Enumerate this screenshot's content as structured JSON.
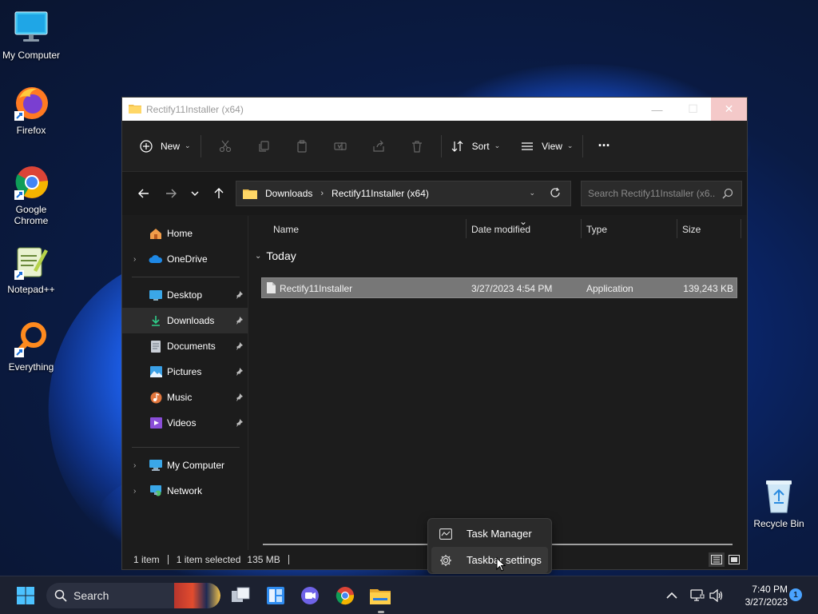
{
  "desktop": {
    "icons": [
      {
        "label": "My Computer",
        "icon": "monitor-icon"
      },
      {
        "label": "Firefox",
        "icon": "firefox-icon"
      },
      {
        "label": "Google Chrome",
        "icon": "chrome-icon"
      },
      {
        "label": "Notepad++",
        "icon": "notepadpp-icon"
      },
      {
        "label": "Everything",
        "icon": "everything-search-icon"
      },
      {
        "label": "Recycle Bin",
        "icon": "recycle-bin-icon"
      }
    ]
  },
  "window": {
    "title": "Rectify11Installer (x64)",
    "controls": {
      "minimize": "—",
      "maximize": "☐",
      "close": "✕"
    }
  },
  "command_bar": {
    "new_label": "New",
    "sort_label": "Sort",
    "view_label": "View",
    "more_label": "···"
  },
  "address_bar": {
    "crumbs": [
      "Downloads",
      "Rectify11Installer (x64)"
    ],
    "search_placeholder": "Search Rectify11Installer (x6..."
  },
  "nav_pane": {
    "items": [
      {
        "label": "Home",
        "icon": "home-icon"
      },
      {
        "label": "OneDrive",
        "icon": "onedrive-icon"
      },
      {
        "label": "Desktop",
        "icon": "desktop-folder-icon",
        "pinned": true
      },
      {
        "label": "Downloads",
        "icon": "downloads-icon",
        "pinned": true,
        "selected": true
      },
      {
        "label": "Documents",
        "icon": "documents-icon",
        "pinned": true
      },
      {
        "label": "Pictures",
        "icon": "pictures-icon",
        "pinned": true
      },
      {
        "label": "Music",
        "icon": "music-icon",
        "pinned": true
      },
      {
        "label": "Videos",
        "icon": "videos-icon",
        "pinned": true
      },
      {
        "label": "My Computer",
        "icon": "computer-icon"
      },
      {
        "label": "Network",
        "icon": "network-icon"
      }
    ]
  },
  "file_list": {
    "columns": [
      "Name",
      "Date modified",
      "Type",
      "Size"
    ],
    "group": "Today",
    "rows": [
      {
        "name": "Rectify11Installer",
        "date": "3/27/2023 4:54 PM",
        "type": "Application",
        "size": "139,243 KB"
      }
    ]
  },
  "status_bar": {
    "count": "1 item",
    "selected": "1 item selected",
    "size": "135 MB"
  },
  "context_menu": {
    "items": [
      {
        "label": "Task Manager",
        "icon": "task-manager-icon"
      },
      {
        "label": "Taskbar settings",
        "icon": "gear-icon"
      }
    ]
  },
  "taskbar": {
    "search_label": "Search",
    "clock_time": "7:40 PM",
    "clock_date": "3/27/2023",
    "notification_count": "1"
  },
  "colors": {
    "accent": "#4aa3ff",
    "window_bg": "#1c1c1c",
    "selected_row": "#777777"
  }
}
